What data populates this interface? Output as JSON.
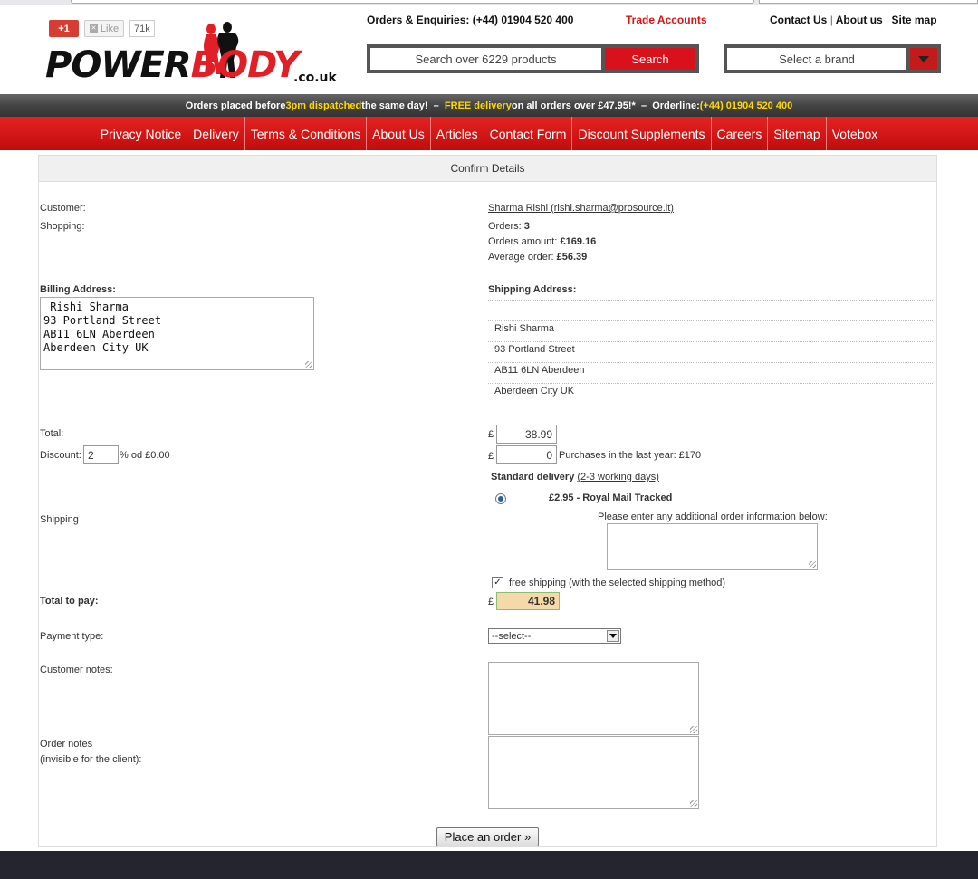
{
  "header": {
    "social": {
      "gplus": "+1",
      "like": "Like",
      "like_count": "71k"
    },
    "logo": {
      "word1": "POWER",
      "word2": "BODY",
      "suffix": ".co.uk"
    },
    "orders_enquiries": "Orders & Enquiries: (+44) 01904 520 400",
    "trade_accounts": "Trade Accounts",
    "contact_us": "Contact Us",
    "about_us": "About us",
    "site_map": "Site map",
    "sep": "|",
    "search_placeholder": "Search over 6229 products",
    "search_button": "Search",
    "brand_select": "Select a brand"
  },
  "promo": {
    "part1": "Orders placed before ",
    "highlight1": "3pm dispatched",
    "part2": " the same day!",
    "dash": "  –  ",
    "highlight2": "FREE delivery",
    "part3": " on all orders over £47.95!*",
    "dash2": "  –  ",
    "part4": "Orderline: ",
    "highlight3": "(+44) 01904 520 400"
  },
  "nav": [
    "Privacy Notice",
    "Delivery",
    "Terms & Conditions",
    "About Us",
    "Articles",
    "Contact Form",
    "Discount Supplements",
    "Careers",
    "Sitemap",
    "Votebox"
  ],
  "form": {
    "title": "Confirm Details",
    "customer_label": "Customer:",
    "customer_value": "Sharma Rishi (rishi.sharma@prosource.it)",
    "shopping_label": "Shopping:",
    "orders_label": "Orders: ",
    "orders_value": "3",
    "orders_amount_label": "Orders amount: ",
    "orders_amount_value": "£169.16",
    "avg_order_label": "Average order: ",
    "avg_order_value": "£56.39",
    "billing_label": "Billing Address:",
    "billing_value": " Rishi Sharma\n93 Portland Street\nAB11 6LN Aberdeen\nAberdeen City UK",
    "shipping_addr_label": "Shipping Address:",
    "shipping_addr_lines": [
      "Rishi Sharma",
      "93 Portland Street",
      "AB11 6LN Aberdeen",
      "Aberdeen City UK"
    ],
    "total_label": "Total:",
    "currency": "£",
    "total_value": "38.99",
    "discount_label": "Discount:",
    "discount_value": "2",
    "discount_suffix": "% od £0.00",
    "discount_amount": "0",
    "purchases_last_year": "Purchases in the last year: £170",
    "delivery_title": "Standard delivery",
    "delivery_days": "(2-3 working days)",
    "delivery_option": "£2.95 - Royal Mail Tracked",
    "shipping_label": "Shipping",
    "additional_info_label": "Please enter any additional order information below:",
    "free_shipping_label": "free shipping (with the selected shipping method)",
    "total_pay_label": "Total to pay:",
    "total_pay_value": "41.98",
    "payment_type_label": "Payment type:",
    "payment_type_value": "--select--",
    "customer_notes_label": "Customer notes:",
    "order_notes_label": "Order notes",
    "order_notes_sub": "(invisible for the client):",
    "place_order_button": "Place an order »"
  },
  "colors": {
    "brand_red": "#d9111b",
    "promo_yellow": "#ffd800",
    "footer": "#24252f"
  }
}
